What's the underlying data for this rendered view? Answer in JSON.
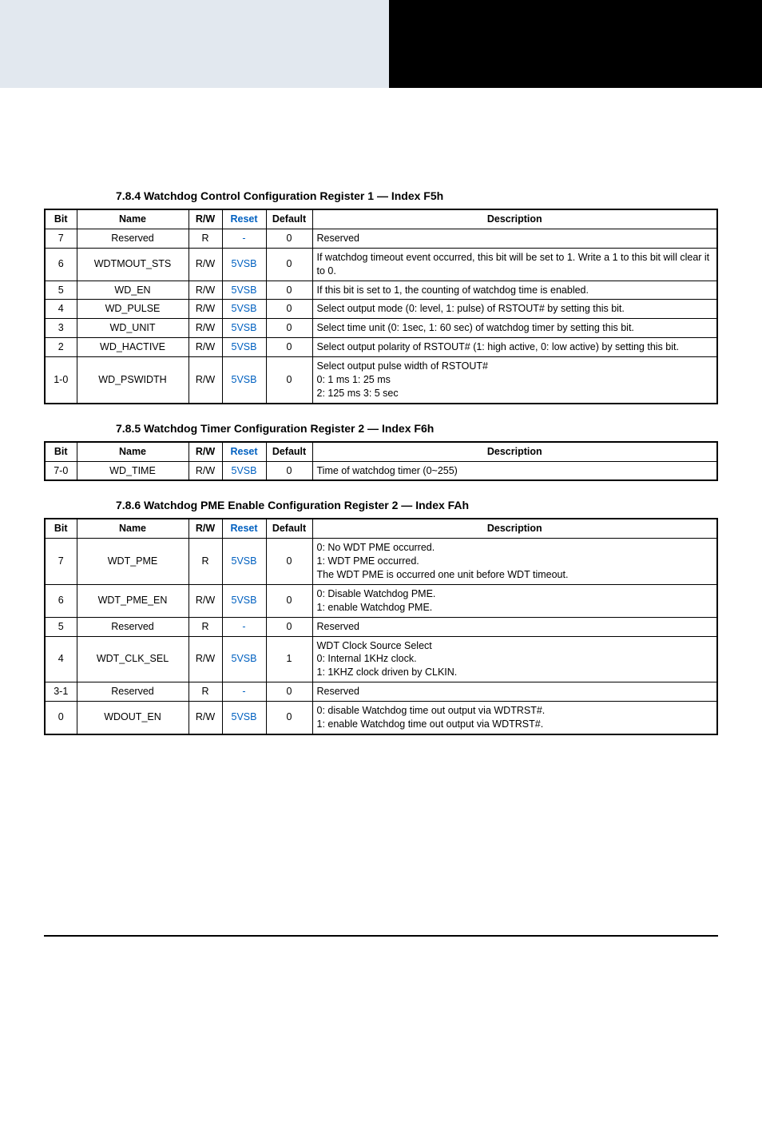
{
  "sections": [
    {
      "id": "s1",
      "title": "7.8.4  Watchdog Control Configuration Register 1 — Index F5h",
      "headers": [
        "Bit",
        "Name",
        "R/W",
        "Reset",
        "Default",
        "Description"
      ],
      "rows": [
        {
          "bit": "7",
          "name": "Reserved",
          "rw": "R",
          "reset": "-",
          "def": "0",
          "desc": "Reserved"
        },
        {
          "bit": "6",
          "name": "WDTMOUT_STS",
          "rw": "R/W",
          "reset": "5VSB",
          "def": "0",
          "desc": "If watchdog timeout event occurred, this bit will be set to 1. Write a 1 to this bit will clear it to 0."
        },
        {
          "bit": "5",
          "name": "WD_EN",
          "rw": "R/W",
          "reset": "5VSB",
          "def": "0",
          "desc": "If this bit is set to 1, the counting of watchdog time is enabled."
        },
        {
          "bit": "4",
          "name": "WD_PULSE",
          "rw": "R/W",
          "reset": "5VSB",
          "def": "0",
          "desc": "Select output mode (0: level, 1: pulse) of RSTOUT# by setting this bit."
        },
        {
          "bit": "3",
          "name": "WD_UNIT",
          "rw": "R/W",
          "reset": "5VSB",
          "def": "0",
          "desc": "Select time unit (0: 1sec, 1: 60 sec) of watchdog timer by setting this bit."
        },
        {
          "bit": "2",
          "name": "WD_HACTIVE",
          "rw": "R/W",
          "reset": "5VSB",
          "def": "0",
          "desc": "Select output polarity of RSTOUT# (1: high active, 0: low active) by setting this bit."
        },
        {
          "bit": "1-0",
          "name": "WD_PSWIDTH",
          "rw": "R/W",
          "reset": "5VSB",
          "def": "0",
          "desc": "Select output pulse width of RSTOUT#\n0: 1 ms            1: 25 ms\n2: 125 ms         3: 5 sec"
        }
      ]
    },
    {
      "id": "s2",
      "title": "7.8.5  Watchdog Timer Configuration Register 2 — Index F6h",
      "headers": [
        "Bit",
        "Name",
        "R/W",
        "Reset",
        "Default",
        "Description"
      ],
      "rows": [
        {
          "bit": "7-0",
          "name": "WD_TIME",
          "rw": "R/W",
          "reset": "5VSB",
          "def": "0",
          "desc": "Time of watchdog timer (0~255)"
        }
      ]
    },
    {
      "id": "s3",
      "title": "7.8.6  Watchdog PME Enable Configuration Register 2 — Index FAh",
      "headers": [
        "Bit",
        "Name",
        "R/W",
        "Reset",
        "Default",
        "Description"
      ],
      "rows": [
        {
          "bit": "7",
          "name": "WDT_PME",
          "rw": "R",
          "reset": "5VSB",
          "def": "0",
          "desc": "0: No WDT PME occurred.\n1: WDT PME occurred.\nThe WDT PME is occurred one unit before WDT timeout."
        },
        {
          "bit": "6",
          "name": "WDT_PME_EN",
          "rw": "R/W",
          "reset": "5VSB",
          "def": "0",
          "desc": "0: Disable Watchdog PME.\n1: enable Watchdog PME."
        },
        {
          "bit": "5",
          "name": "Reserved",
          "rw": "R",
          "reset": "-",
          "def": "0",
          "desc": "Reserved"
        },
        {
          "bit": "4",
          "name": "WDT_CLK_SEL",
          "rw": "R/W",
          "reset": "5VSB",
          "def": "1",
          "desc": "WDT Clock Source Select\n0: Internal 1KHz clock.\n1: 1KHZ clock driven by CLKIN."
        },
        {
          "bit": "3-1",
          "name": "Reserved",
          "rw": "R",
          "reset": "-",
          "def": "0",
          "desc": "Reserved"
        },
        {
          "bit": "0",
          "name": "WDOUT_EN",
          "rw": "R/W",
          "reset": "5VSB",
          "def": "0",
          "desc": "0: disable Watchdog time out output via WDTRST#.\n1: enable Watchdog time out output via WDTRST#."
        }
      ]
    }
  ]
}
